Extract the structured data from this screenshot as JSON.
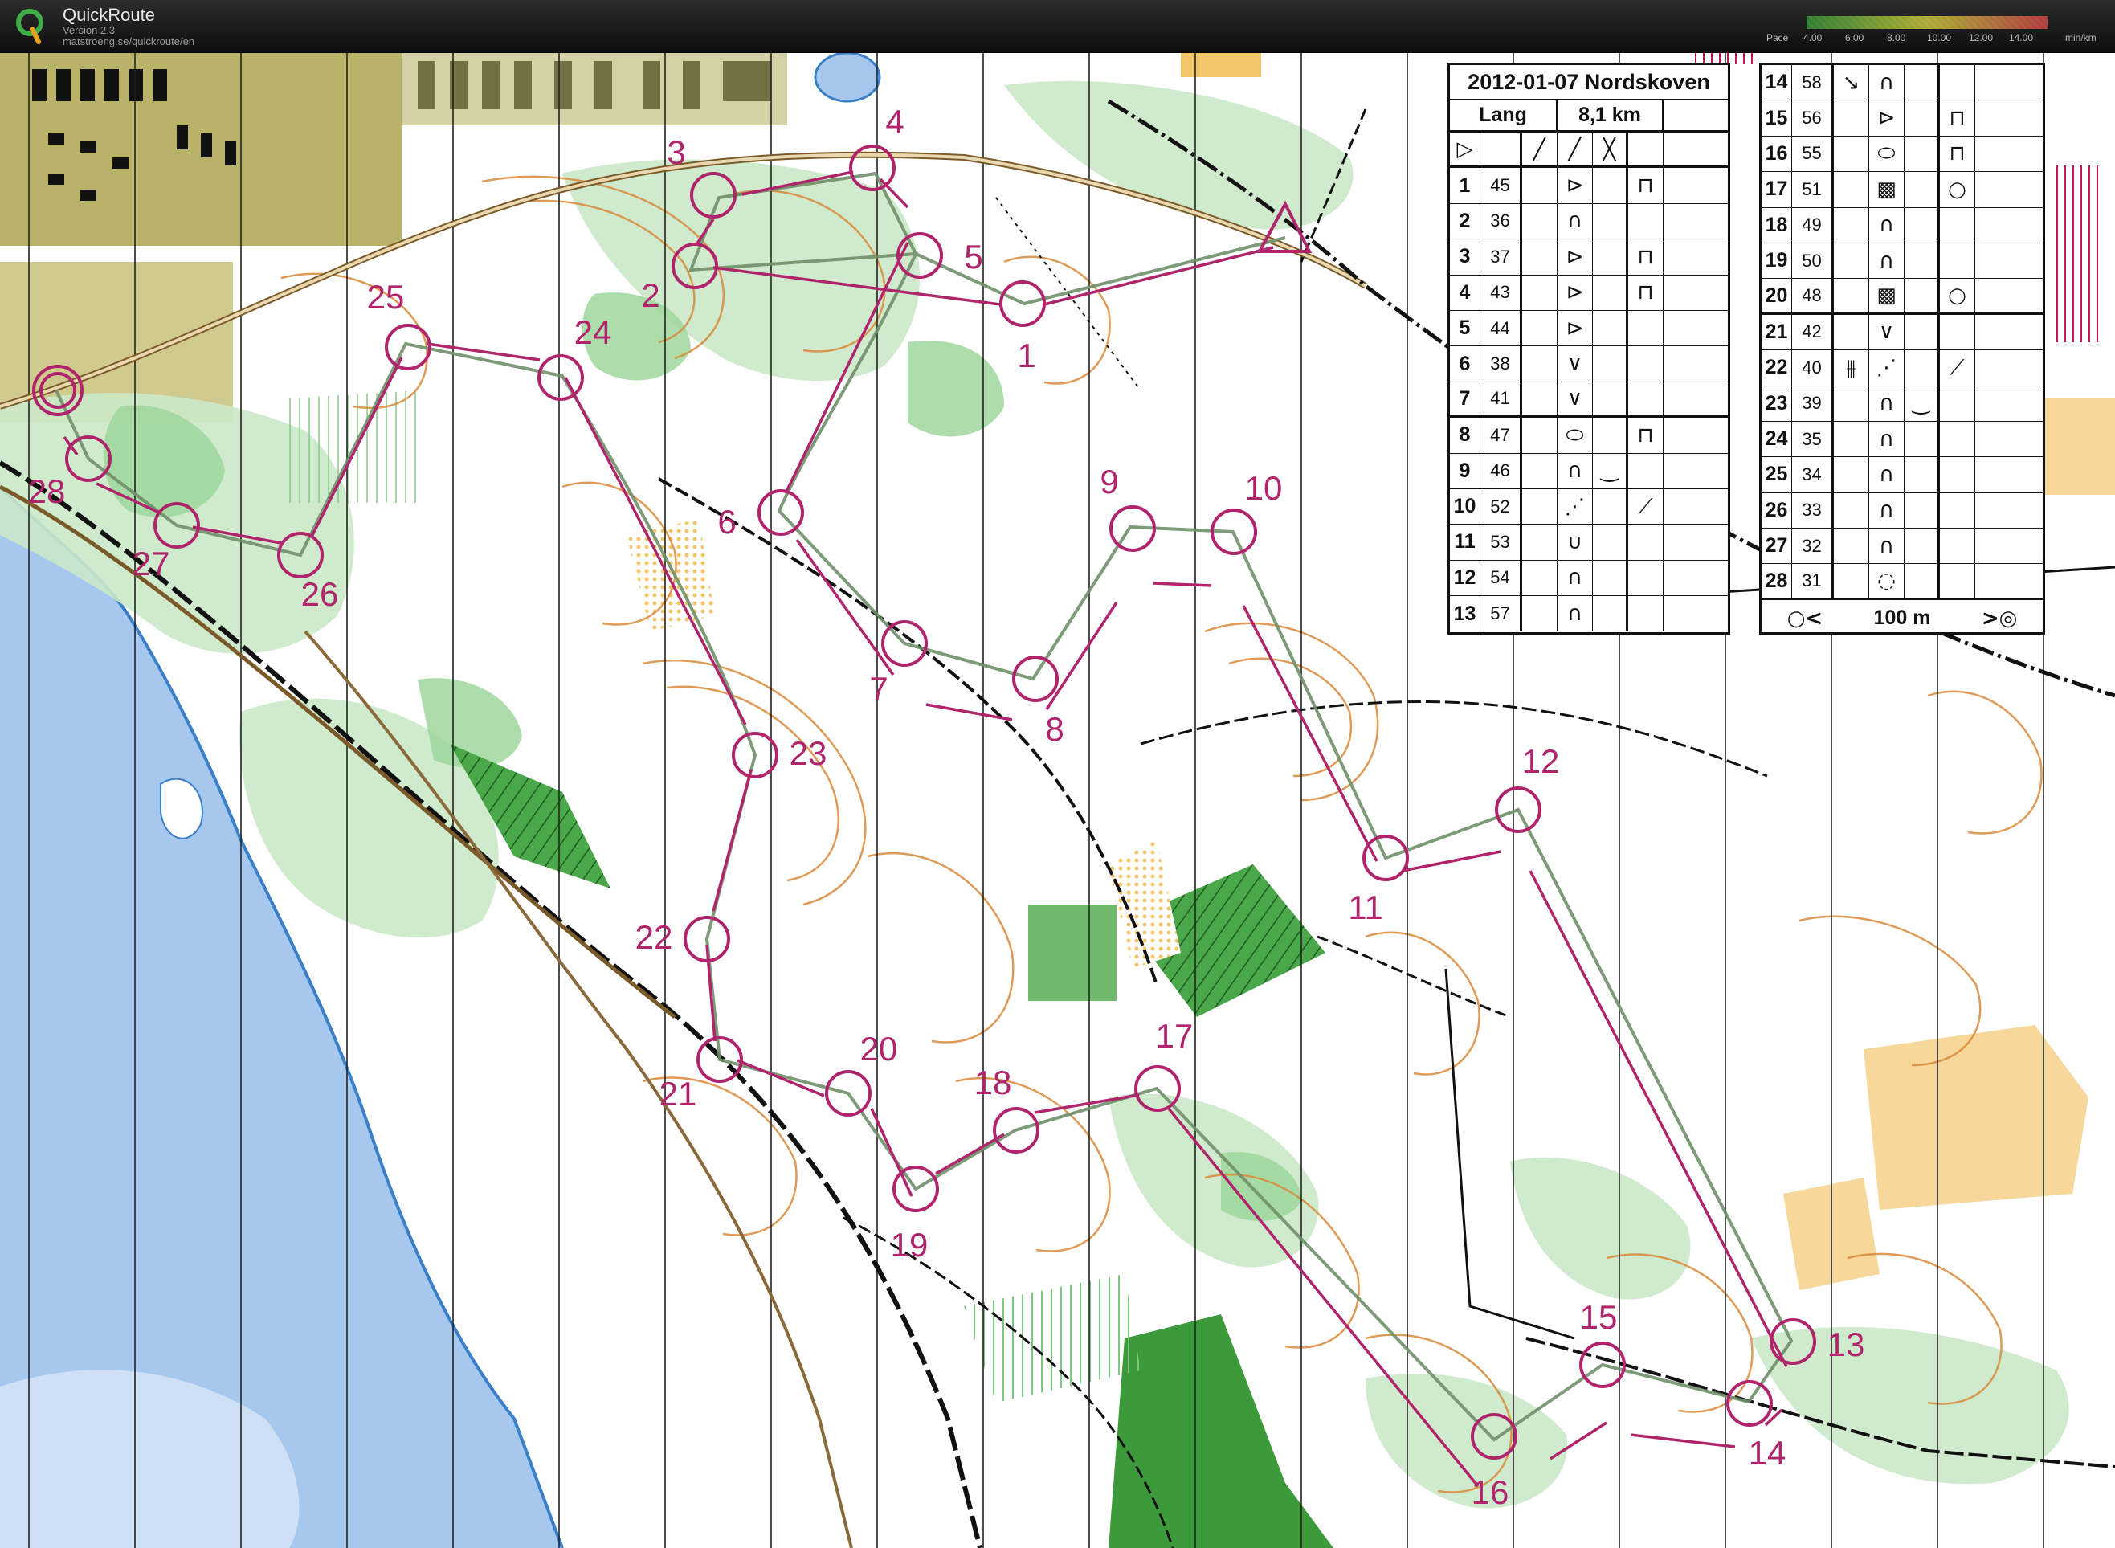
{
  "app": {
    "name": "QuickRoute",
    "version": "Version 2.3",
    "url": "matstroeng.se/quickroute/en",
    "logo_letter": "Q",
    "logo_icon": "quickroute-q-logo"
  },
  "pace_scale": {
    "label": "Pace",
    "ticks": [
      "4.00",
      "6.00",
      "8.00",
      "10.00",
      "12.00",
      "14.00"
    ],
    "unit": "min/km",
    "colors": [
      "#3aa33a",
      "#e0e040",
      "#e34a4a"
    ]
  },
  "course": {
    "title": "2012-01-07 Nordskoven",
    "class": "Lang",
    "length": "8,1 km",
    "start_symbol": "triangle-start-icon",
    "finish_distance": "100 m",
    "route_color": "#b0246c",
    "controls": [
      {
        "no": "1",
        "code": "45"
      },
      {
        "no": "2",
        "code": "36"
      },
      {
        "no": "3",
        "code": "37"
      },
      {
        "no": "4",
        "code": "43"
      },
      {
        "no": "5",
        "code": "44"
      },
      {
        "no": "6",
        "code": "38"
      },
      {
        "no": "7",
        "code": "41"
      },
      {
        "no": "8",
        "code": "47"
      },
      {
        "no": "9",
        "code": "46"
      },
      {
        "no": "10",
        "code": "52"
      },
      {
        "no": "11",
        "code": "53"
      },
      {
        "no": "12",
        "code": "54"
      },
      {
        "no": "13",
        "code": "57"
      },
      {
        "no": "14",
        "code": "58"
      },
      {
        "no": "15",
        "code": "56"
      },
      {
        "no": "16",
        "code": "55"
      },
      {
        "no": "17",
        "code": "51"
      },
      {
        "no": "18",
        "code": "49"
      },
      {
        "no": "19",
        "code": "50"
      },
      {
        "no": "20",
        "code": "48"
      },
      {
        "no": "21",
        "code": "42"
      },
      {
        "no": "22",
        "code": "40"
      },
      {
        "no": "23",
        "code": "39"
      },
      {
        "no": "24",
        "code": "35"
      },
      {
        "no": "25",
        "code": "34"
      },
      {
        "no": "26",
        "code": "33"
      },
      {
        "no": "27",
        "code": "32"
      },
      {
        "no": "28",
        "code": "31"
      }
    ]
  }
}
